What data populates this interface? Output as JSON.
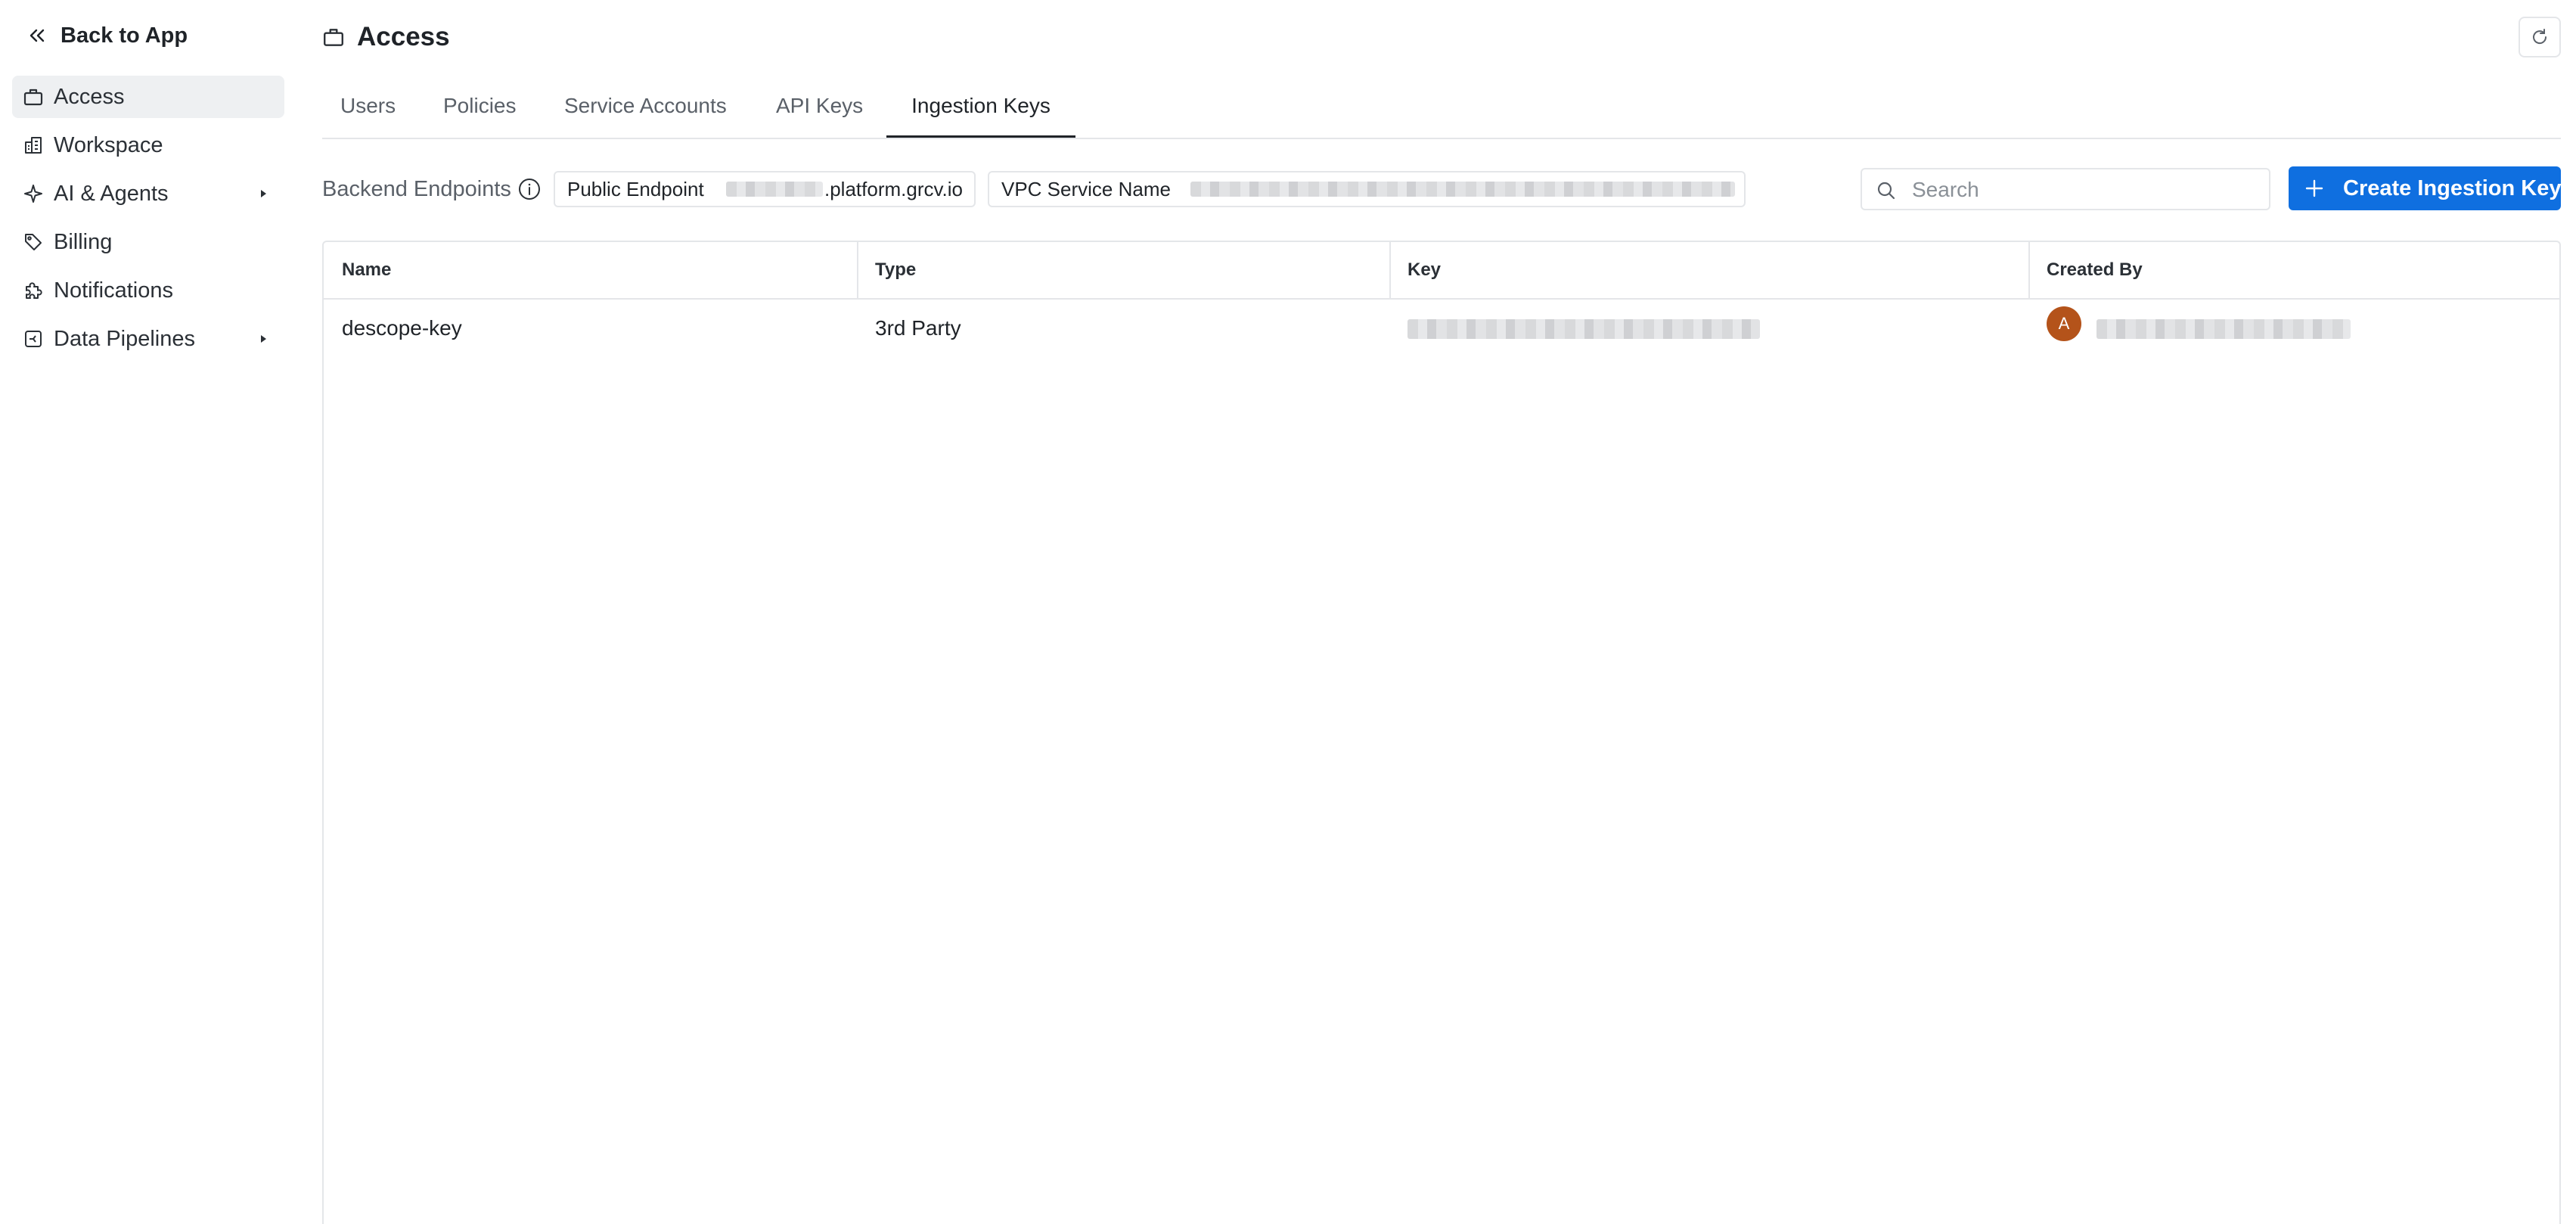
{
  "sidebar": {
    "back_label": "Back to App",
    "items": [
      {
        "label": "Access",
        "icon": "briefcase-icon",
        "active": true,
        "has_submenu": false
      },
      {
        "label": "Workspace",
        "icon": "building-icon",
        "active": false,
        "has_submenu": false
      },
      {
        "label": "AI & Agents",
        "icon": "sparkle-icon",
        "active": false,
        "has_submenu": true
      },
      {
        "label": "Billing",
        "icon": "tag-icon",
        "active": false,
        "has_submenu": false
      },
      {
        "label": "Notifications",
        "icon": "puzzle-icon",
        "active": false,
        "has_submenu": false
      },
      {
        "label": "Data Pipelines",
        "icon": "pipeline-icon",
        "active": false,
        "has_submenu": true
      }
    ]
  },
  "header": {
    "title": "Access",
    "title_icon": "briefcase-icon",
    "refresh_icon": "refresh-icon"
  },
  "tabs": [
    {
      "label": "Users",
      "active": false
    },
    {
      "label": "Policies",
      "active": false
    },
    {
      "label": "Service Accounts",
      "active": false
    },
    {
      "label": "API Keys",
      "active": false
    },
    {
      "label": "Ingestion Keys",
      "active": true
    }
  ],
  "toolbar": {
    "backend_endpoints_label": "Backend Endpoints",
    "public_endpoint": {
      "label": "Public Endpoint",
      "value_suffix": ".platform.grcv.io"
    },
    "vpc_service": {
      "label": "VPC Service Name"
    },
    "search_placeholder": "Search",
    "create_button_label": "Create Ingestion Key"
  },
  "table": {
    "columns": [
      "Name",
      "Type",
      "Key",
      "Created By"
    ],
    "rows": [
      {
        "name": "descope-key",
        "type": "3rd Party",
        "created_by_initial": "A"
      }
    ]
  },
  "colors": {
    "accent": "#0f6fe0",
    "avatar": "#b4531a",
    "active_nav_bg": "#eef0f2",
    "border": "#e4e6e9"
  }
}
